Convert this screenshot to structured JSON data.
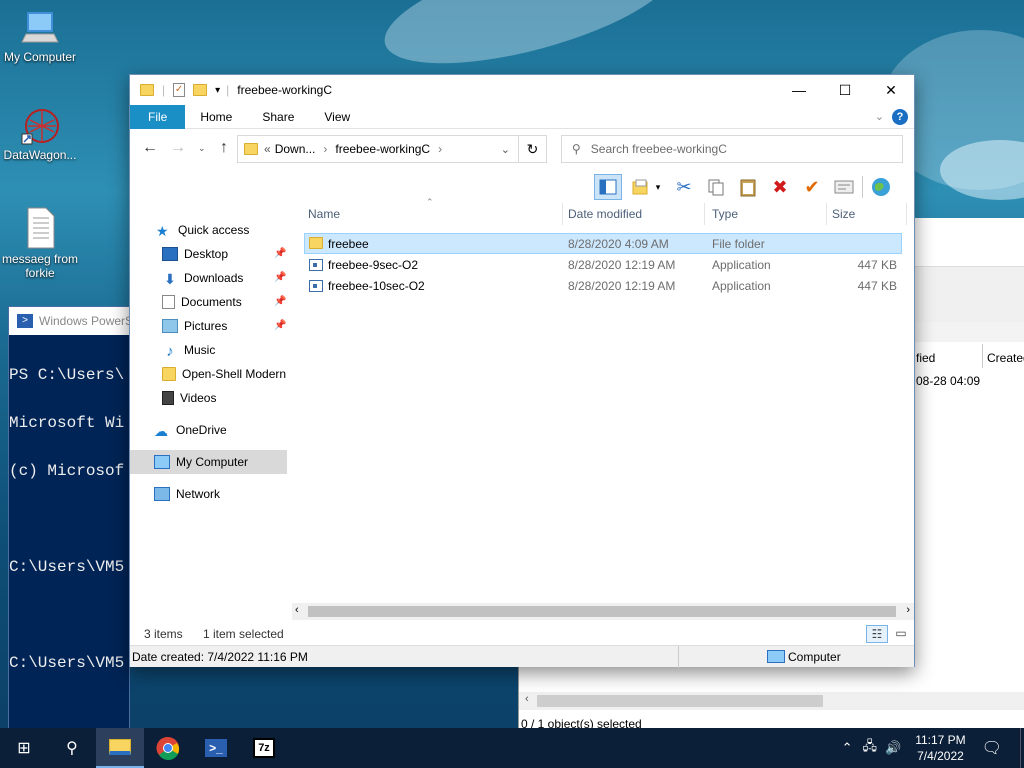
{
  "desktop": {
    "icons": [
      {
        "label": "My Computer"
      },
      {
        "label": "DataWagon..."
      },
      {
        "label": "messaeg from forkie"
      }
    ]
  },
  "powershell": {
    "title": "Windows PowerS",
    "lines": [
      "PS C:\\Users\\",
      "Microsoft Wi",
      "(c) Microsof",
      "",
      "C:\\Users\\VM5",
      "",
      "C:\\Users\\VM5"
    ]
  },
  "bg_explorer": {
    "col_modified_partial": "fied",
    "col_created_partial": "Created",
    "row_date_partial": "08-28 04:09",
    "status": "0 / 1 object(s) selected"
  },
  "window": {
    "title": "freebee-workingC",
    "ribbon_tabs": [
      "File",
      "Home",
      "Share",
      "View"
    ],
    "address": {
      "prefix": "«",
      "crumb1": "Down...",
      "crumb2": "freebee-workingC"
    },
    "search_placeholder": "Search freebee-workingC",
    "nav": {
      "quick_access": "Quick access",
      "desktop": "Desktop",
      "downloads": "Downloads",
      "documents": "Documents",
      "pictures": "Pictures",
      "music": "Music",
      "open_shell": "Open-Shell Modern",
      "videos": "Videos",
      "onedrive": "OneDrive",
      "my_computer": "My Computer",
      "network": "Network"
    },
    "columns": {
      "name": "Name",
      "date": "Date modified",
      "type": "Type",
      "size": "Size"
    },
    "files": [
      {
        "name": "freebee",
        "date": "8/28/2020 4:09 AM",
        "type": "File folder",
        "size": ""
      },
      {
        "name": "freebee-9sec-O2",
        "date": "8/28/2020 12:19 AM",
        "type": "Application",
        "size": "447 KB"
      },
      {
        "name": "freebee-10sec-O2",
        "date": "8/28/2020 12:19 AM",
        "type": "Application",
        "size": "447 KB"
      }
    ],
    "status": {
      "items": "3 items",
      "selected": "1 item selected"
    },
    "details": {
      "created": "Date created: 7/4/2022 11:16 PM",
      "location": "Computer"
    }
  },
  "taskbar": {
    "time": "11:17 PM",
    "date": "7/4/2022",
    "seven_zip_label": "7z"
  }
}
